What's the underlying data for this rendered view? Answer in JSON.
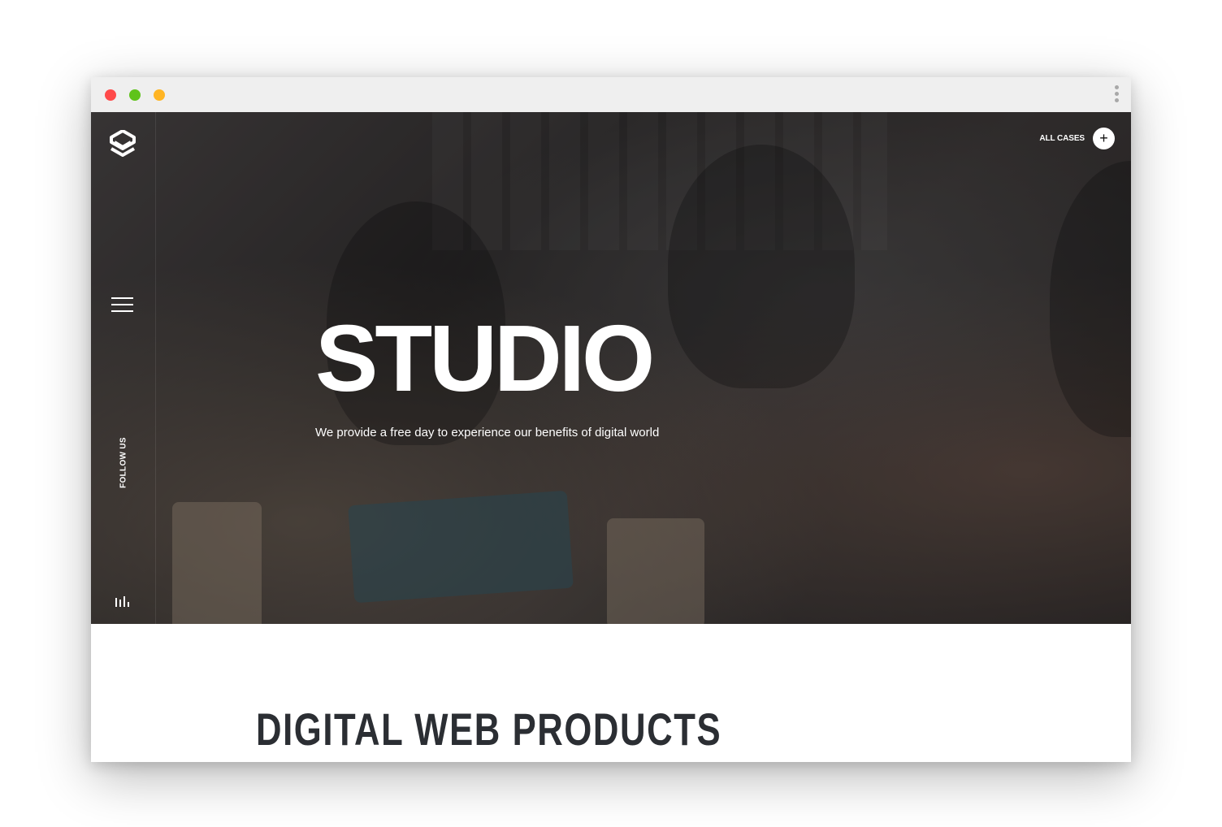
{
  "window": {
    "buttons": [
      "close",
      "zoom",
      "minimize"
    ]
  },
  "hero": {
    "title": "STUDIO",
    "subtitle": "We provide a free day to experience our benefits of digital world",
    "all_cases_label": "ALL CASES",
    "plus_symbol": "+"
  },
  "sidebar": {
    "follow_label": "FOLLOW US"
  },
  "section": {
    "heading": "DIGITAL WEB PRODUCTS"
  },
  "colors": {
    "titlebar": "#efefef",
    "close": "#ff4a4a",
    "green": "#5fc31a",
    "yellow": "#ffb524",
    "heading": "#2b2e33",
    "white": "#ffffff"
  },
  "icons": [
    "logo-mark-icon",
    "hamburger-menu-icon",
    "audio-bars-icon",
    "plus-icon",
    "kebab-menu-icon"
  ]
}
